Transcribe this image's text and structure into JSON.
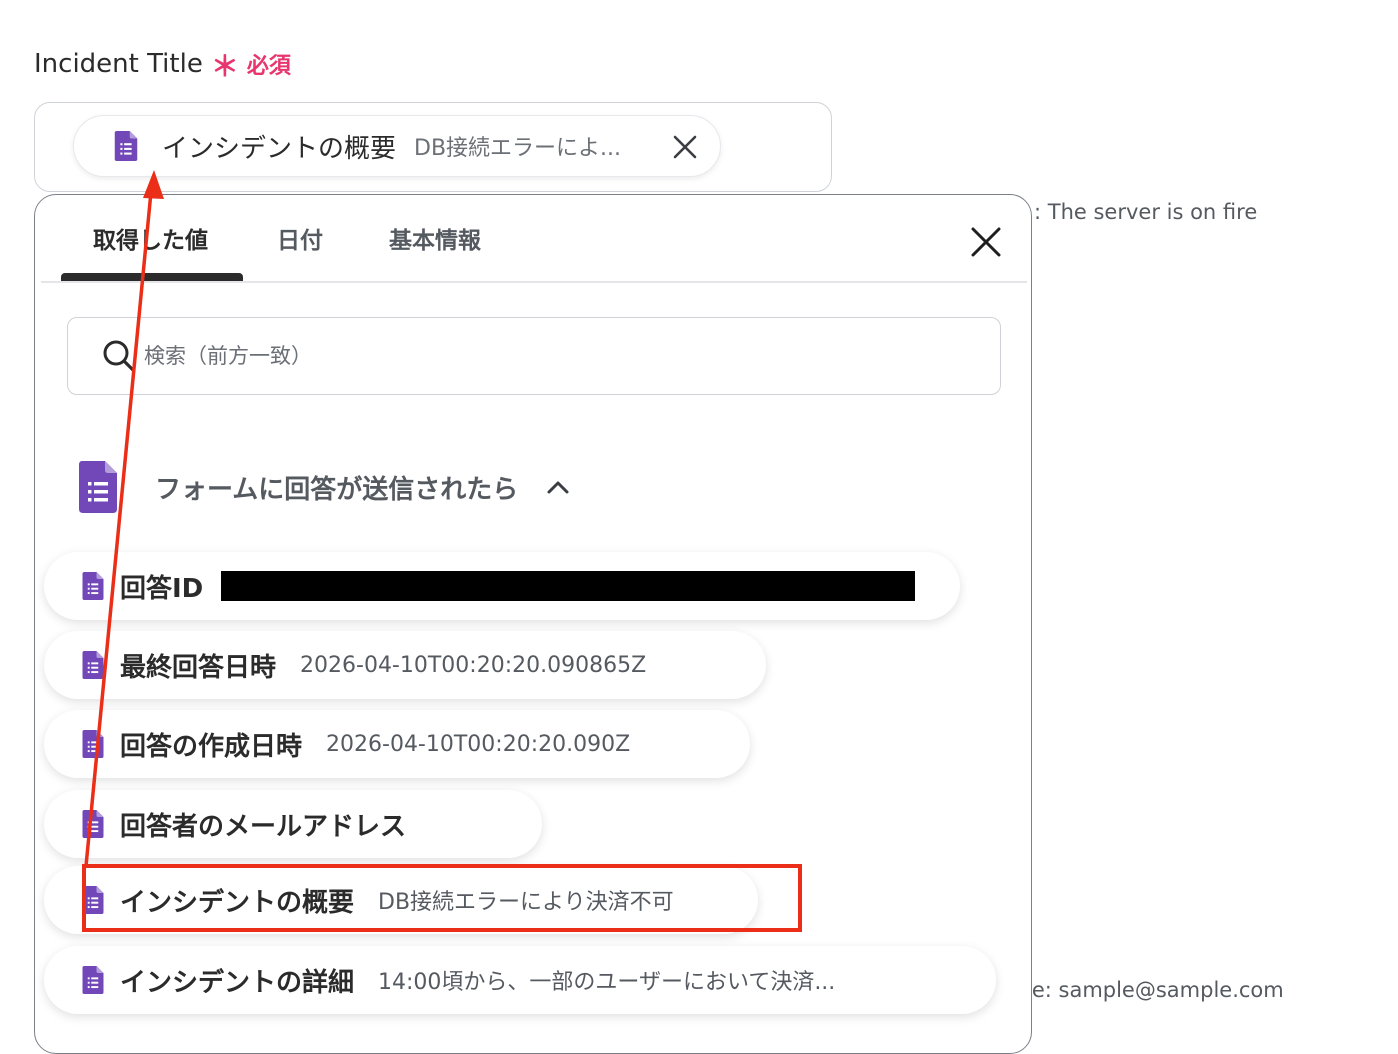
{
  "field": {
    "label": "Incident Title",
    "required_mark": "＊",
    "required_text": "必須"
  },
  "chip": {
    "label": "インシデントの概要",
    "value": "DB接続エラーによ..."
  },
  "background_hints": {
    "hint_1": ": The server is on fire",
    "hint_2": "le: sample@sample.com"
  },
  "tabs": [
    {
      "label": "取得した値",
      "active": true
    },
    {
      "label": "日付",
      "active": false
    },
    {
      "label": "基本情報",
      "active": false
    }
  ],
  "search": {
    "placeholder": "検索（前方一致）"
  },
  "section": {
    "title": "フォームに回答が送信されたら",
    "expanded": true
  },
  "items": [
    {
      "label": "回答ID",
      "value": "",
      "redacted": true
    },
    {
      "label": "最終回答日時",
      "value": "2026-04-10T00:20:20.090865Z"
    },
    {
      "label": "回答の作成日時",
      "value": "2026-04-10T00:20:20.090Z"
    },
    {
      "label": "回答者のメールアドレス",
      "value": ""
    },
    {
      "label": "インシデントの概要",
      "value": "DB接続エラーにより決済不可",
      "highlighted": true
    },
    {
      "label": "インシデントの詳細",
      "value": "14:00頃から、一部のユーザーにおいて決済..."
    }
  ],
  "colors": {
    "required": "#e8356d",
    "forms_icon": "#7248b9",
    "annotation": "#ea2e17"
  }
}
